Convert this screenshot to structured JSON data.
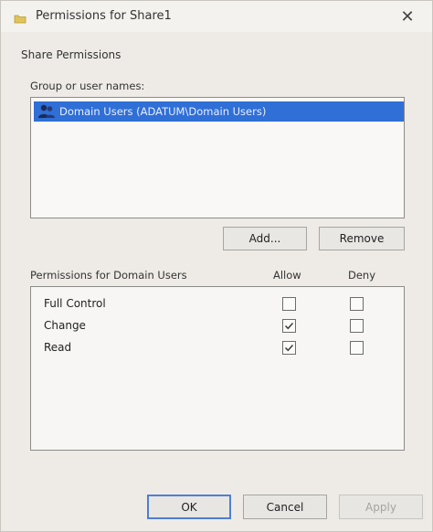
{
  "window": {
    "title": "Permissions for Share1",
    "close_glyph": "✕"
  },
  "tab": {
    "label": "Share Permissions"
  },
  "group": {
    "label": "Group or user names:",
    "items": [
      {
        "name": "Domain Users (ADATUM\\Domain Users)",
        "selected": true
      }
    ]
  },
  "buttons": {
    "add": "Add...",
    "remove": "Remove"
  },
  "permissions": {
    "label": "Permissions for Domain Users",
    "allow_header": "Allow",
    "deny_header": "Deny",
    "rows": [
      {
        "name": "Full Control",
        "allow": false,
        "deny": false
      },
      {
        "name": "Change",
        "allow": true,
        "deny": false
      },
      {
        "name": "Read",
        "allow": true,
        "deny": false
      }
    ]
  },
  "footer": {
    "ok": "OK",
    "cancel": "Cancel",
    "apply": "Apply"
  },
  "colors": {
    "selection": "#2f6fd6",
    "dialog_bg": "#eeebe6",
    "default_button_border": "#4f7fd1"
  },
  "icons": {
    "title": "share-folder-icon",
    "user": "users-group-icon",
    "close": "close-icon"
  }
}
